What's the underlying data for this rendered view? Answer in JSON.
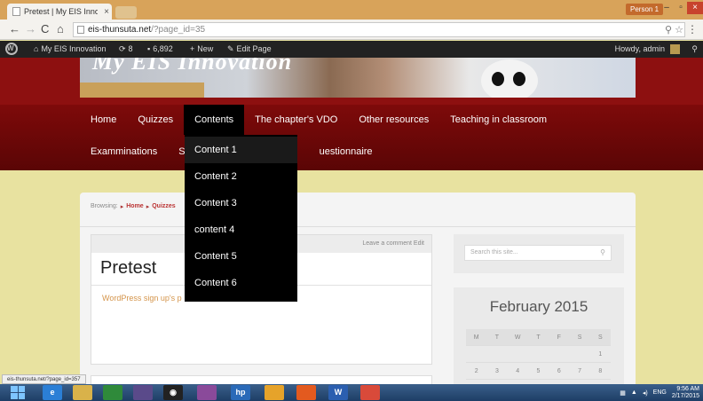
{
  "browser": {
    "tab_title": "Pretest | My EIS Innovatio",
    "tab_close": "×",
    "person_label": "Person 1",
    "url_host": "eis-thunsuta.net",
    "url_path": "/?page_id=35",
    "status_url": "eis-thunsuta.net/?page_id=357"
  },
  "adminbar": {
    "site_name": "My EIS Innovation",
    "updates_count": "8",
    "comments_count": "6,892",
    "new_label": "New",
    "edit_label": "Edit Page",
    "howdy_label": "Howdy, admin"
  },
  "header": {
    "site_title": "My EIS Innovation"
  },
  "nav": {
    "row1": [
      "Home",
      "Quizzes",
      "Contents",
      "The chapter's VDO",
      "Other resources",
      "Teaching in classroom"
    ],
    "row2": [
      "Examminations",
      "St",
      "uestionnaire"
    ],
    "active": "Contents"
  },
  "dropdown": {
    "items": [
      "Content 1",
      "Content 2",
      "Content 3",
      "content 4",
      "Content 5",
      "Content 6"
    ]
  },
  "breadcrumb": {
    "prefix": "Browsing:",
    "home": "Home",
    "quizzes": "Quizzes"
  },
  "post": {
    "meta": "Leave a comment   Edit",
    "title": "Pretest",
    "link_text": "WordPress sign up's p"
  },
  "sidebar": {
    "search_placeholder": "Search this site...",
    "calendar_title": "February 2015",
    "weekdays": [
      "M",
      "T",
      "W",
      "T",
      "F",
      "S",
      "S"
    ],
    "week1": [
      "",
      "",
      "",
      "",
      "",
      "",
      "1"
    ],
    "week2": [
      "2",
      "3",
      "4",
      "5",
      "6",
      "7",
      "8"
    ]
  },
  "taskbar": {
    "lang": "ENG",
    "time": "9:56 AM",
    "date": "2/17/2015"
  },
  "colors": {
    "header_red": "#8d1010",
    "nav_red": "#7e0a0a",
    "page_bg": "#e8e2a0",
    "link_orange": "#d4944a"
  }
}
